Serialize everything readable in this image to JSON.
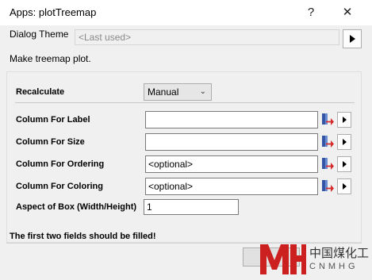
{
  "window": {
    "title": "Apps: plotTreemap",
    "help_label": "?",
    "close_label": "✕"
  },
  "theme": {
    "label": "Dialog Theme",
    "value": "<Last used>"
  },
  "description": "Make treemap plot.",
  "form": {
    "recalculate": {
      "label": "Recalculate",
      "value": "Manual"
    },
    "column_label": {
      "label": "Column For Label",
      "value": ""
    },
    "column_size": {
      "label": "Column For Size",
      "value": ""
    },
    "column_ordering": {
      "label": "Column For Ordering",
      "value": "<optional>"
    },
    "column_coloring": {
      "label": "Column For Coloring",
      "value": "<optional>"
    },
    "aspect": {
      "label": "Aspect of Box (Width/Height)",
      "value": "1"
    }
  },
  "status": "The first two fields should be filled!",
  "watermark": {
    "chinese": "中国煤化工",
    "latin": "CNMHG"
  },
  "colors": {
    "dialog_bg": "#f0f0f0",
    "titlebar_bg": "#ffffff",
    "watermark_red": "#cc1f1f"
  }
}
